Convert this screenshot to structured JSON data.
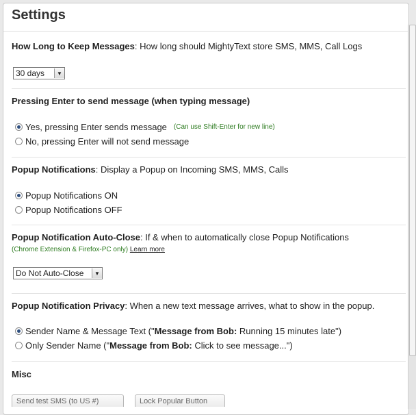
{
  "title": "Settings",
  "retention": {
    "heading_bold": "How Long to Keep Messages",
    "heading_rest": ": How long should MightyText store SMS, MMS, Call Logs",
    "selected": "30 days"
  },
  "enter": {
    "heading_bold": "Pressing Enter to send message (when typing message)",
    "opt1": "Yes, pressing Enter sends message",
    "opt1_hint": "(Can use Shift-Enter for new line)",
    "opt2": "No, pressing Enter will not send message"
  },
  "popup": {
    "heading_bold": "Popup Notifications",
    "heading_rest": ": Display a Popup on Incoming SMS, MMS, Calls",
    "opt1": "Popup Notifications ON",
    "opt2": "Popup Notifications OFF"
  },
  "autoclose": {
    "heading_bold": "Popup Notification Auto-Close",
    "heading_rest": ": If & when to automatically close Popup Notifications",
    "note": "(Chrome Extension & Firefox-PC only)",
    "learn_more": "Learn more",
    "selected": "Do Not Auto-Close"
  },
  "privacy": {
    "heading_bold": "Popup Notification Privacy",
    "heading_rest": ": When a new text message arrives, what to show in the popup.",
    "opt1_pre": "Sender Name & Message Text (\"",
    "opt1_bold": "Message from Bob:",
    "opt1_post": " Running 15 minutes late\")",
    "opt2_pre": "Only Sender Name (\"",
    "opt2_bold": "Message from Bob:",
    "opt2_post": " Click to see message...\")"
  },
  "misc": {
    "heading_bold": "Misc",
    "button1": "Send test SMS (to US #)",
    "button2": "Lock Popular Button"
  }
}
